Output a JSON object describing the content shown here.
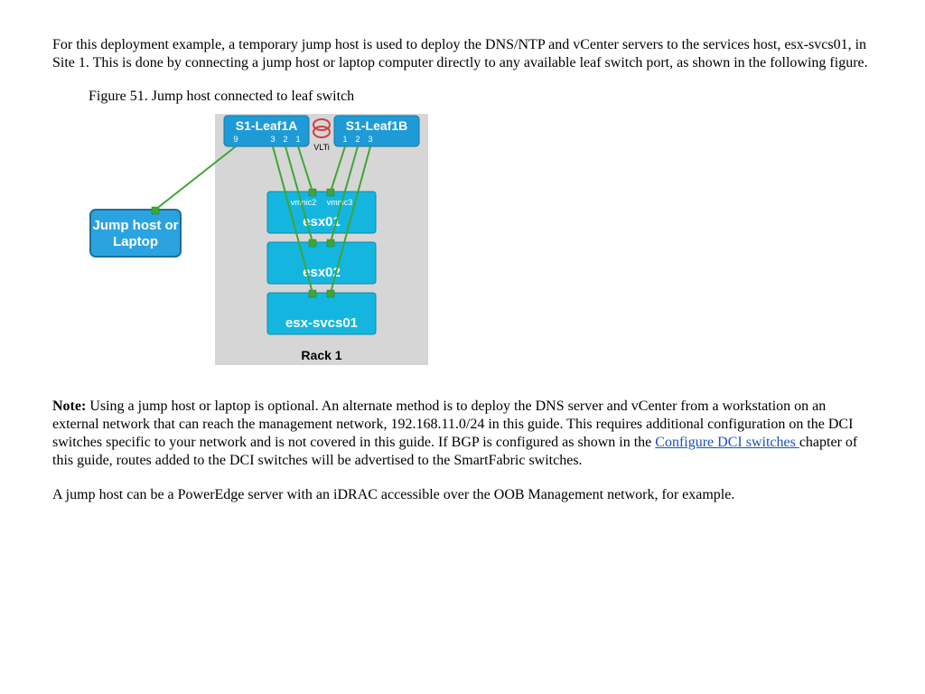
{
  "intro_paragraph": "For this deployment example, a temporary jump host is used to deploy the DNS/NTP and vCenter servers to the services host, esx-svcs01, in Site 1. This is done by connecting a jump host or laptop computer directly to any available leaf switch port, as shown in the following figure.",
  "figure": {
    "caption": "Figure 51. Jump host connected to leaf switch",
    "diagram": {
      "rack_label": "Rack 1",
      "vlti_label": "VLTi",
      "switches": [
        {
          "name": "S1-Leaf1A",
          "ports": [
            "9",
            "3",
            "2",
            "1"
          ]
        },
        {
          "name": "S1-Leaf1B",
          "ports": [
            "1",
            "2",
            "3"
          ]
        }
      ],
      "jump_host": {
        "line1": "Jump host or",
        "line2": "Laptop"
      },
      "hosts": [
        {
          "name": "esx01",
          "nics": [
            "vmnic2",
            "vmnic3"
          ]
        },
        {
          "name": "esx02"
        },
        {
          "name": "esx-svcs01"
        }
      ]
    }
  },
  "note": {
    "label": "Note:",
    "before_link": "Using a jump host or laptop is optional. An alternate method is to deploy the DNS server and vCenter from a workstation on an external network that can reach the management network, 192.168.11.0/24 in this guide. This requires additional configuration on the DCI switches specific to your network and is not covered in this guide. If BGP is configured as shown in the ",
    "link_text": "Configure DCI switches ",
    "after_link": "chapter of this guide, routes added to the DCI switches will be advertised to the SmartFabric switches."
  },
  "closing_paragraph": "A jump host can be a PowerEdge server with an iDRAC accessible over the OOB Management network, for example."
}
